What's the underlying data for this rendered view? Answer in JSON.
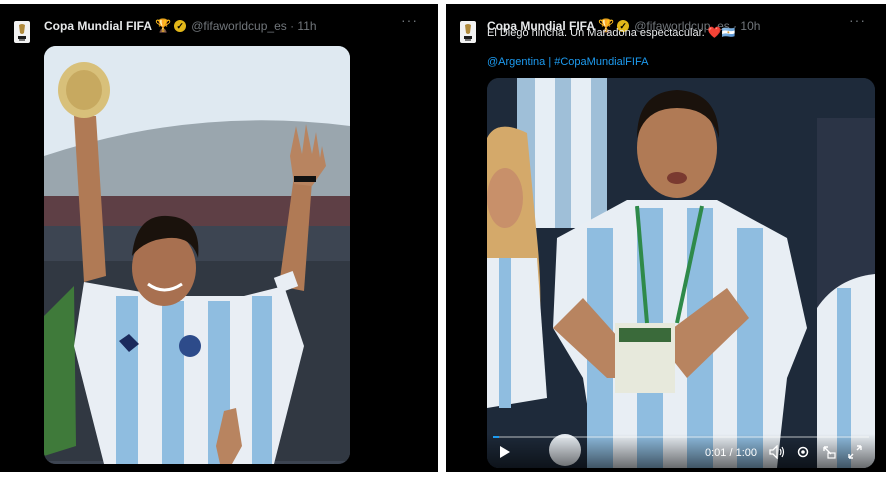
{
  "left_post": {
    "account_name": "Copa Mundial FIFA",
    "handle_and_time": "@fifaworldcup_es · 11h",
    "more": "···"
  },
  "right_post": {
    "account_name": "Copa Mundial FIFA",
    "handle_and_time": "@fifaworldcup_es · 10h",
    "more": "···",
    "text": "El Diego hincha. Un Maradona espectacular.",
    "emoji": "❤️🇦🇷",
    "hashtag_1": "@Argentina",
    "separator": "|",
    "hashtag_2": "#CopaMundialFIFA",
    "video": {
      "time": "0:01 / 1:00",
      "progress": 0.017
    }
  },
  "colors": {
    "background": "#000000",
    "text": "#e7e9ea",
    "muted": "#71767b",
    "link": "#1d9bf0",
    "badge": "#e2b719"
  },
  "icons": {
    "play": "play-icon",
    "volume": "volume-icon",
    "settings": "settings-icon",
    "pip": "picture-in-picture-icon",
    "fullscreen": "fullscreen-icon"
  }
}
